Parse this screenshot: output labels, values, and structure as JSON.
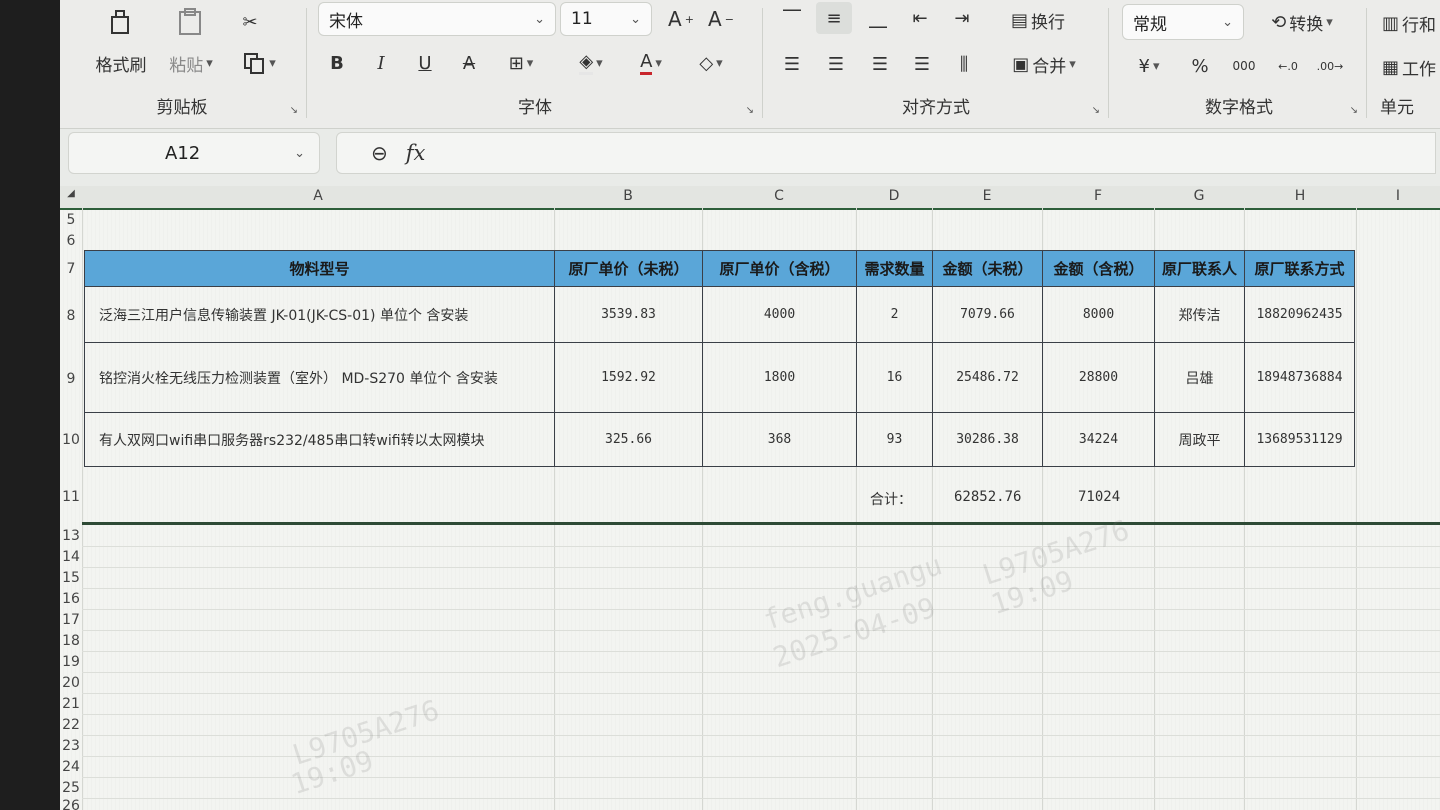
{
  "ribbon": {
    "clipboard": {
      "format_painter": "格式刷",
      "paste": "粘贴",
      "group_label": "剪贴板"
    },
    "font": {
      "font_name": "宋体",
      "font_size": "11",
      "group_label": "字体"
    },
    "alignment": {
      "wrap_text": "换行",
      "merge": "合并",
      "group_label": "对齐方式"
    },
    "number": {
      "format": "常规",
      "convert": "转换",
      "group_label": "数字格式"
    },
    "cells": {
      "row_col": "行和",
      "worksheet": "工作",
      "group_label": "单元"
    }
  },
  "formula_bar": {
    "name_box": "A12",
    "fx_label": "fx"
  },
  "columns": [
    "A",
    "B",
    "C",
    "D",
    "E",
    "F",
    "G",
    "H",
    "I"
  ],
  "rows_above": [
    "5",
    "6"
  ],
  "table": {
    "header_row_num": "7",
    "headers": [
      "物料型号",
      "原厂单价（未税）",
      "原厂单价（含税）",
      "需求数量",
      "金额（未税）",
      "金额（含税）",
      "原厂联系人",
      "原厂联系方式"
    ],
    "rows": [
      {
        "num": "8",
        "cells": [
          "泛海三江用户信息传输装置 JK-01(JK-CS-01) 单位个 含安装",
          "3539.83",
          "4000",
          "2",
          "7079.66",
          "8000",
          "郑传洁",
          "18820962435"
        ]
      },
      {
        "num": "9",
        "cells": [
          "铭控消火栓无线压力检测装置（室外） MD-S270 单位个 含安装",
          "1592.92",
          "1800",
          "16",
          "25486.72",
          "28800",
          "吕雄",
          "18948736884"
        ]
      },
      {
        "num": "10",
        "cells": [
          "有人双网口wifi串口服务器rs232/485串口转wifi转以太网模块",
          "325.66",
          "368",
          "93",
          "30286.38",
          "34224",
          "周政平",
          "13689531129"
        ]
      }
    ]
  },
  "totals": {
    "row_num": "11",
    "label": "合计：",
    "amount_untaxed": "62852.76",
    "amount_taxed": "71024"
  },
  "rows_below": [
    "13",
    "14",
    "15",
    "16",
    "17",
    "18",
    "19",
    "20",
    "21",
    "22",
    "23",
    "24",
    "25",
    "26"
  ],
  "watermarks": [
    "feng.guangu",
    "2025-04-09",
    "L9705A276",
    "19:09"
  ],
  "colors": {
    "header_fill": "#5aa6d8",
    "ribbon_bg": "#ececea",
    "grid_bg": "#f3f4f1"
  }
}
